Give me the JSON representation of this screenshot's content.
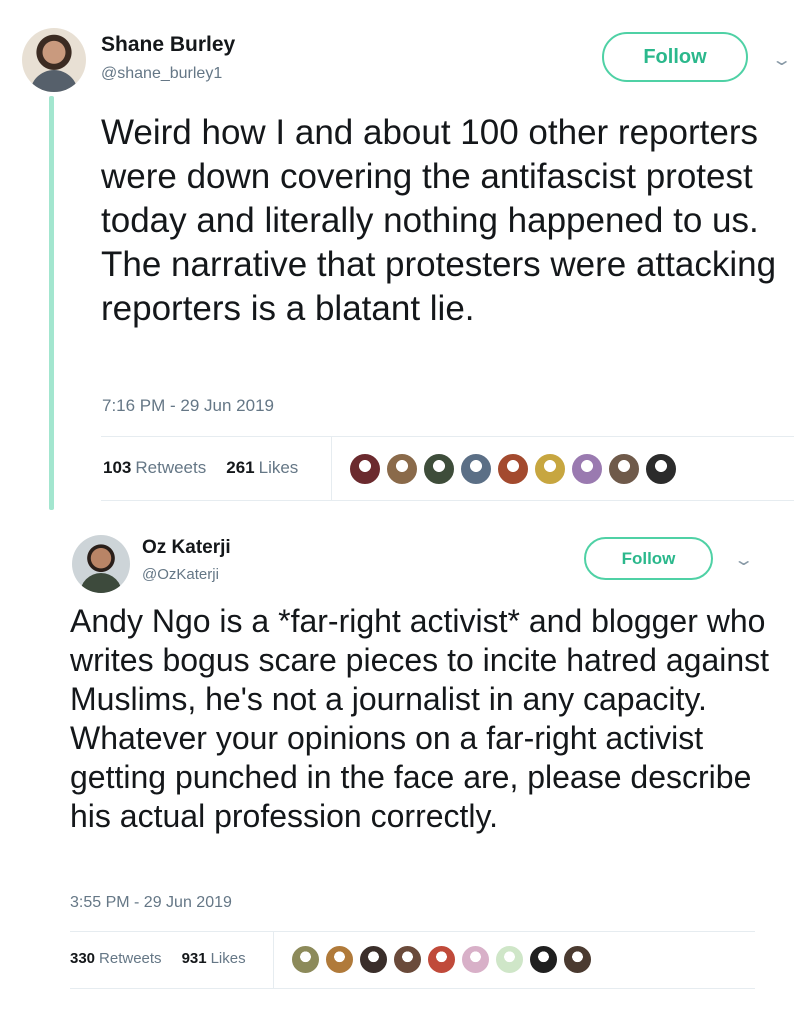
{
  "tweets": [
    {
      "name": "Shane Burley",
      "handle": "@shane_burley1",
      "follow_label": "Follow",
      "menu_icon": "chevron-down-icon",
      "text": "Weird how I and about 100 other reporters were down covering the antifascist protest today and literally nothing happened to us. The narrative that protesters were attacking reporters is a blatant lie.",
      "timestamp": "7:16 PM - 29 Jun 2019",
      "retweets_count": "103",
      "retweets_label": "Retweets",
      "likes_count": "261",
      "likes_label": "Likes",
      "liker_avatar_colors": [
        "#6b2a2e",
        "#8a6a4a",
        "#3e4d3a",
        "#5b6f86",
        "#a34a2e",
        "#c7a640",
        "#9a7ab0",
        "#6f5a4a",
        "#2b2b2b"
      ]
    },
    {
      "name": "Oz Katerji",
      "handle": "@OzKaterji",
      "follow_label": "Follow",
      "menu_icon": "chevron-down-icon",
      "text": "Andy Ngo is a *far-right activist* and blogger who writes bogus scare pieces to incite hatred against Muslims, he's not a journalist in any capacity. Whatever your opinions on a far-right activist getting punched in the face are, please describe his actual profession correctly.",
      "timestamp": "3:55 PM - 29 Jun 2019",
      "retweets_count": "330",
      "retweets_label": "Retweets",
      "likes_count": "931",
      "likes_label": "Likes",
      "liker_avatar_colors": [
        "#8c8a5a",
        "#b07a3a",
        "#3a2e2a",
        "#6a4a3a",
        "#c04a3a",
        "#d8b0c8",
        "#cfe6c8",
        "#1f1f1f",
        "#4a3a30"
      ]
    }
  ],
  "accent_color": "#4fd1a5",
  "thread_line_color": "#a3e6cf"
}
